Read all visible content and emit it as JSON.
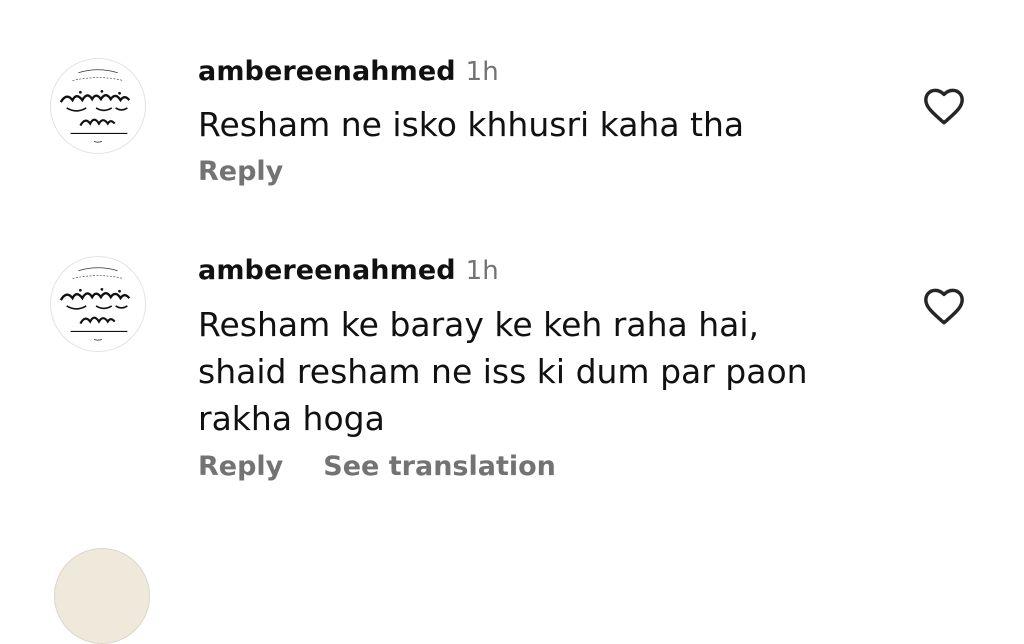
{
  "comments": [
    {
      "username": "ambereenahmed",
      "time": "1h",
      "lines": [
        "Resham ne isko khhusri kaha tha"
      ],
      "reply_label": "Reply",
      "translation_label": ""
    },
    {
      "username": "ambereenahmed",
      "time": "1h",
      "lines": [
        "Resham ke baray ke keh raha hai,",
        "shaid resham ne iss ki dum par paon",
        "rakha hoga"
      ],
      "reply_label": "Reply",
      "translation_label": "See translation"
    }
  ],
  "icons": {
    "avatar": "calligraphy-avatar-icon",
    "like": "heart-outline-icon"
  },
  "colors": {
    "text": "#111111",
    "secondary": "#737373",
    "background": "#ffffff"
  }
}
